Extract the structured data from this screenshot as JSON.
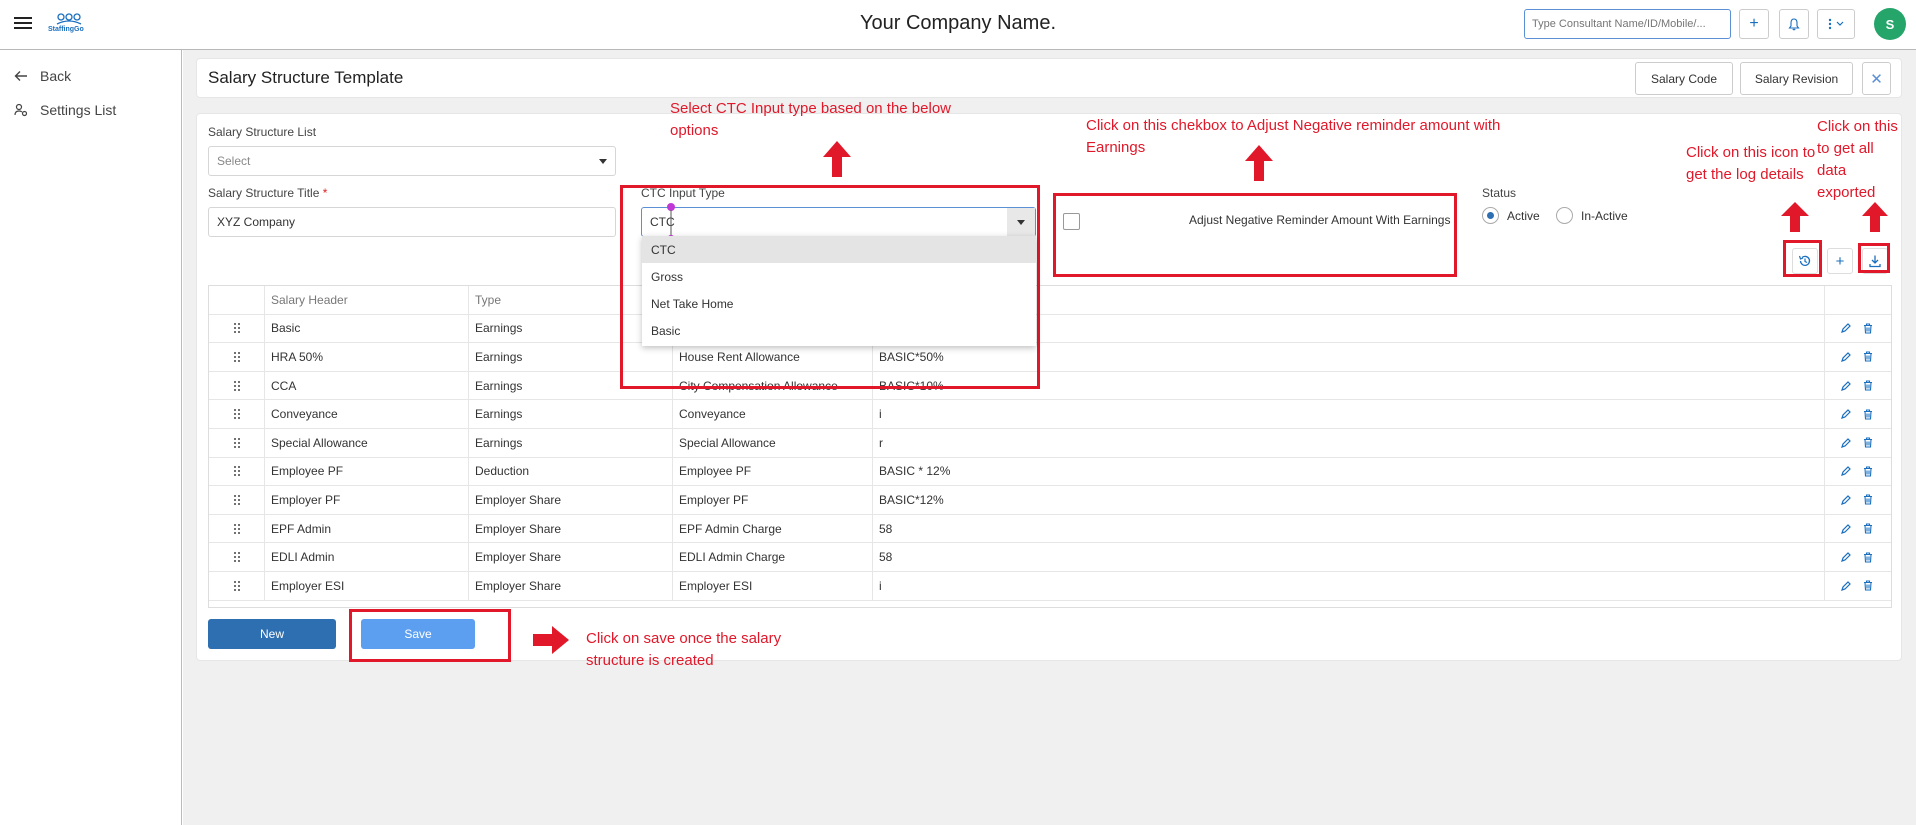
{
  "header": {
    "company": "Your Company Name.",
    "logo_text": "StaffingGo",
    "search_placeholder": "Type Consultant Name/ID/Mobile/...",
    "avatar_initial": "S"
  },
  "sidebar": {
    "items": [
      {
        "label": "Back",
        "icon": "arrow-left-icon"
      },
      {
        "label": "Settings List",
        "icon": "user-settings-icon"
      }
    ]
  },
  "page": {
    "title": "Salary Structure Template",
    "buttons": {
      "salary_code": "Salary Code",
      "salary_revision": "Salary Revision"
    }
  },
  "form": {
    "list_label": "Salary Structure List",
    "list_placeholder": "Select",
    "title_label": "Salary Structure Title",
    "title_required_mark": "*",
    "title_value": "XYZ Company",
    "ctc_label": "CTC Input Type",
    "ctc_value": "CTC",
    "ctc_options": [
      "CTC",
      "Gross",
      "Net Take Home",
      "Basic"
    ],
    "adjust_label": "Adjust Negative Reminder Amount With Earnings",
    "status_label": "Status",
    "status_options": [
      "Active",
      "In-Active"
    ],
    "status_selected": "Active"
  },
  "table": {
    "headers": [
      "Salary Header",
      "Type",
      "",
      ""
    ],
    "rows": [
      [
        "Basic",
        "Earnings",
        "",
        ""
      ],
      [
        "HRA 50%",
        "Earnings",
        "House Rent Allowance",
        "BASIC*50%"
      ],
      [
        "CCA",
        "Earnings",
        "City Compensation Allowance",
        "BASIC*10%"
      ],
      [
        "Conveyance",
        "Earnings",
        "Conveyance",
        "i"
      ],
      [
        "Special Allowance",
        "Earnings",
        "Special Allowance",
        "r"
      ],
      [
        "Employee PF",
        "Deduction",
        "Employee PF",
        "BASIC * 12%"
      ],
      [
        "Employer PF",
        "Employer Share",
        "Employer PF",
        "BASIC*12%"
      ],
      [
        "EPF Admin",
        "Employer Share",
        "EPF Admin Charge",
        "58"
      ],
      [
        "EDLI Admin",
        "Employer Share",
        "EDLI Admin Charge",
        "58"
      ],
      [
        "Employer ESI",
        "Employer Share",
        "Employer ESI",
        "i"
      ]
    ]
  },
  "actions": {
    "new": "New",
    "save": "Save"
  },
  "annotations": {
    "ctc": "Select CTC Input type based on the below options",
    "checkbox": "Click on this chekbox to Adjust Negative reminder amount with Earnings",
    "log": "Click on this icon to get the log details",
    "export": "Click on this to get all data exported",
    "save": "Click on save once the salary structure is created"
  },
  "colors": {
    "annotation": "#e0182a",
    "primary": "#2d6fb1",
    "save": "#5c9ff0",
    "avatar": "#25a56a"
  }
}
